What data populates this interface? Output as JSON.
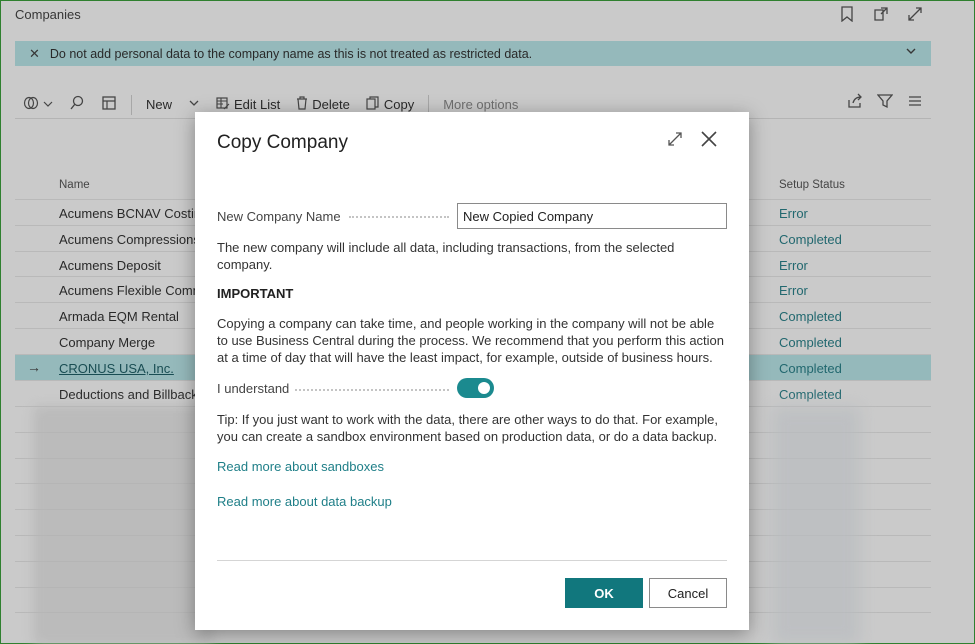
{
  "page": {
    "title": "Companies",
    "banner_text": "Do not add personal data to the company name as this is not treated as restricted data."
  },
  "toolbar": {
    "new_label": "New",
    "edit_list_label": "Edit List",
    "delete_label": "Delete",
    "copy_label": "Copy",
    "more_options_label": "More options"
  },
  "list": {
    "columns": {
      "name": "Name",
      "setup_status": "Setup Status"
    },
    "rows": [
      {
        "name": "Acumens BCNAV Costing",
        "status": "Error"
      },
      {
        "name": "Acumens Compressions",
        "status": "Completed"
      },
      {
        "name": "Acumens Deposit",
        "status": "Error"
      },
      {
        "name": "Acumens Flexible Comm",
        "status": "Error"
      },
      {
        "name": "Armada EQM Rental",
        "status": "Completed"
      },
      {
        "name": "Company Merge",
        "status": "Completed"
      },
      {
        "name": "CRONUS USA, Inc.",
        "status": "Completed"
      },
      {
        "name": "Deductions and Billback",
        "status": "Completed"
      }
    ]
  },
  "dialog": {
    "title": "Copy Company",
    "new_company_name_label": "New Company Name",
    "new_company_name_value": "New Copied Company",
    "info_text": "The new company will include all data, including transactions, from the selected company.",
    "important_heading": "IMPORTANT",
    "important_text": "Copying a company can take time, and people working in the company will not be able to use Business Central during the process. We recommend that you perform this action at a time of day that will have the least impact, for example, outside of business hours.",
    "understand_label": "I understand",
    "understand_value": true,
    "tip_text": "Tip: If you just want to work with the data, there are other ways to do that. For example, you can create a sandbox environment based on production data, or do a data backup.",
    "link_sandboxes": "Read more about sandboxes",
    "link_backup": "Read more about data backup",
    "ok_label": "OK",
    "cancel_label": "Cancel"
  },
  "colors": {
    "accent": "#11777d",
    "banner_bg": "#b6e2e4",
    "status_text": "#2a7f88"
  }
}
